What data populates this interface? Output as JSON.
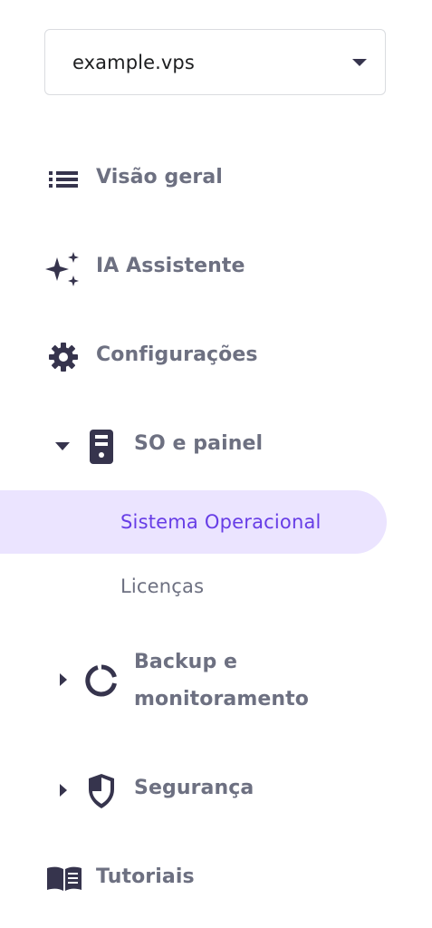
{
  "selector": {
    "value": "example.vps"
  },
  "nav": {
    "overview": {
      "label": "Visão geral"
    },
    "ai_assistant": {
      "label": "IA Assistente"
    },
    "settings": {
      "label": "Configurações"
    },
    "os_panel": {
      "label": "SO e painel",
      "expanded": true,
      "children": [
        {
          "label": "Sistema Operacional",
          "active": true
        },
        {
          "label": "Licenças",
          "active": false
        }
      ]
    },
    "backup": {
      "label_line1": "Backup e",
      "label_line2": "monitoramento",
      "expanded": false
    },
    "security": {
      "label": "Segurança",
      "expanded": false
    },
    "tutorials": {
      "label": "Tutoriais"
    }
  },
  "colors": {
    "accent": "#673de6",
    "active_bg": "#ebe4ff",
    "icon": "#36344d",
    "label": "#6d7081"
  },
  "icons": {
    "overview": "list-icon",
    "ai_assistant": "sparkles-icon",
    "settings": "gear-icon",
    "os_panel": "server-icon",
    "backup": "circle-progress-icon",
    "security": "shield-icon",
    "tutorials": "book-icon"
  }
}
